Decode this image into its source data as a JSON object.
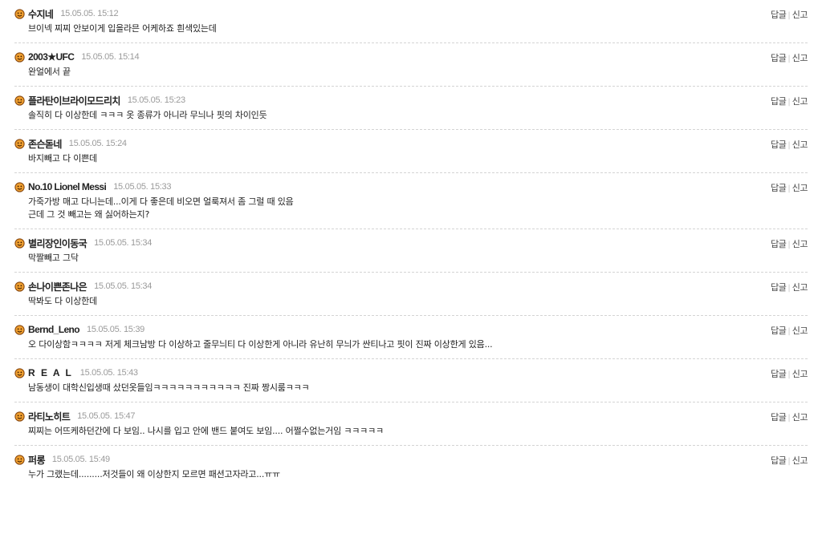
{
  "actions": {
    "reply": "답글",
    "separator": "|",
    "report": "신고"
  },
  "avatar_icon": "smiley-face-icon",
  "colors": {
    "avatar_fill": "#f0a030",
    "avatar_outline": "#8a4a10",
    "divider": "#d4d4d4",
    "date": "#9a9a9a"
  },
  "comments": [
    {
      "nick": "수지네",
      "date": "15.05.05. 15:12",
      "lines": [
        "브이넥 찌찌 안보이게 입을라믄 어케하죠 흰색있는데"
      ]
    },
    {
      "nick": "2003★UFC",
      "date": "15.05.05. 15:14",
      "lines": [
        "완얼에서 끝"
      ]
    },
    {
      "nick": "플라탄이브라이모드리치",
      "date": "15.05.05. 15:23",
      "lines": [
        "솔직히 다 이상한데 ㅋㅋㅋ 옷 종류가 아니라 무늬나 핏의 차이인듯"
      ]
    },
    {
      "nick": "존슨돋네",
      "date": "15.05.05. 15:24",
      "lines": [
        "바지빼고 다 이쁜데"
      ]
    },
    {
      "nick": "No.10 Lionel Messi",
      "date": "15.05.05. 15:33",
      "lines": [
        "가죽가방 매고 다니는데...이게 다 좋은데 비오면 얼룩져서 좀 그럴 때 있음",
        "근데 그 것 빼고는 왜 싫어하는지?"
      ]
    },
    {
      "nick": "별리장인이동국",
      "date": "15.05.05. 15:34",
      "lines": [
        "막짤빼고 그닥"
      ]
    },
    {
      "nick": "손나이쁜존나은",
      "date": "15.05.05. 15:34",
      "lines": [
        "딱봐도 다 이상한데"
      ]
    },
    {
      "nick": "Bernd_Leno",
      "date": "15.05.05. 15:39",
      "lines": [
        "오 다이상함ㅋㅋㅋㅋ 저게 체크남방 다 이상하고 줄무늬티 다 이상한게 아니라 유난히 무늬가 싼티나고 핏이 진짜 이상한게 있음..."
      ]
    },
    {
      "nick": "R E A L",
      "date": "15.05.05. 15:43",
      "lines": [
        "남동생이 대학신입생때 샀던옷들임ㅋㅋㅋㅋㅋㅋㅋㅋㅋㅋㅋ 진짜 짱시룸ㅋㅋㅋ"
      ]
    },
    {
      "nick": "라티노히트",
      "date": "15.05.05. 15:47",
      "lines": [
        "찌찌는 어뜨케하던간에 다 보임.. 나시를 입고 안에 밴드 붙여도 보임.... 어쩔수없는거임 ㅋㅋㅋㅋㅋ"
      ]
    },
    {
      "nick": "퍼롱",
      "date": "15.05.05. 15:49",
      "lines": [
        "누가 그랬는데.........저것들이 왜 이상한지 모르면 패션고자라고...ㅠㅠ"
      ]
    }
  ]
}
